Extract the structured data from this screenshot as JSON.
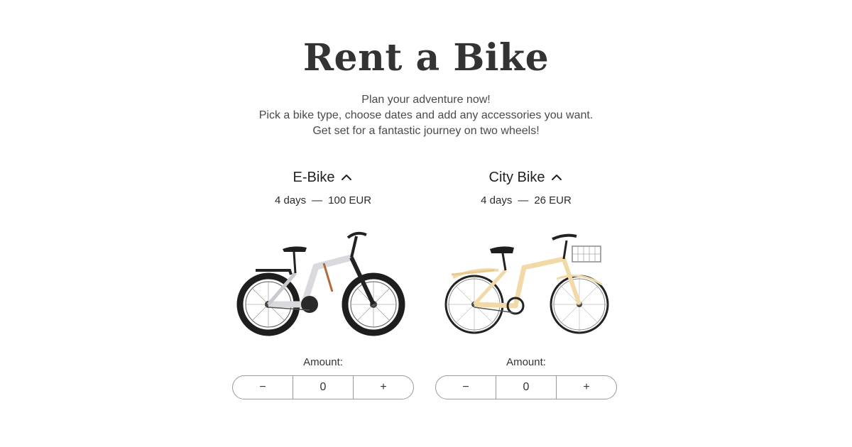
{
  "header": {
    "title": "Rent a Bike",
    "intro_lines": [
      "Plan your adventure now!",
      "Pick a bike type, choose dates and add any accessories you want.",
      "Get set for a fantastic journey on two wheels!"
    ]
  },
  "bikes": [
    {
      "name": "E-Bike",
      "duration": "4 days",
      "separator": "—",
      "price": "100 EUR",
      "expand_icon": "chevron-up-icon",
      "amount_label": "Amount:",
      "amount_value": "0",
      "minus_symbol": "−",
      "plus_symbol": "+",
      "frame_color": "#d9d9de"
    },
    {
      "name": "City Bike",
      "duration": "4 days",
      "separator": "—",
      "price": "26 EUR",
      "expand_icon": "chevron-up-icon",
      "amount_label": "Amount:",
      "amount_value": "0",
      "minus_symbol": "−",
      "plus_symbol": "+",
      "frame_color": "#f2d9a8"
    }
  ]
}
